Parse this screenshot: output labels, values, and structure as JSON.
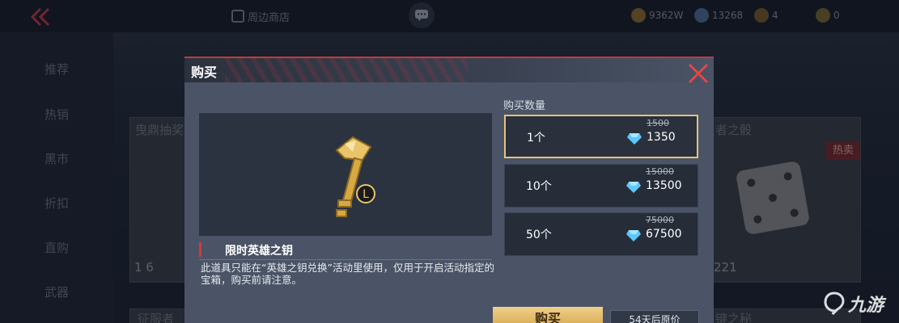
{
  "topbar": {
    "shop_tab": "周边商店",
    "currencies": [
      {
        "icon": "gold-coin-icon",
        "value": "9362W"
      },
      {
        "icon": "credit-icon",
        "value": "13268"
      },
      {
        "icon": "token-icon",
        "value": "4"
      },
      {
        "icon": "voucher-icon",
        "value": "0"
      }
    ]
  },
  "sidebar": {
    "items": [
      {
        "label": "推荐"
      },
      {
        "label": "热销"
      },
      {
        "label": "黑市"
      },
      {
        "label": "折扣"
      },
      {
        "label": "直购"
      },
      {
        "label": "武器"
      }
    ]
  },
  "background_cards": {
    "card1_title": "曳鼎抽奖",
    "card1_value": "1 6",
    "card2_title": "者之骰",
    "card2_badge": "热卖",
    "card2_value": "221",
    "bottom_left_title": "征服者",
    "bottom_right_title": "键之秘"
  },
  "modal": {
    "title": "购买",
    "item_name": "限时英雄之钥",
    "item_description": "此道具只能在“英雄之钥兑换”活动里使用，仅用于开启活动指定的宝箱，购买前请注意。",
    "quantity_label": "购买数量",
    "options": [
      {
        "qty": "1个",
        "original_price": "1500",
        "price": "1350",
        "selected": true
      },
      {
        "qty": "10个",
        "original_price": "15000",
        "price": "13500",
        "selected": false
      },
      {
        "qty": "50个",
        "original_price": "75000",
        "price": "67500",
        "selected": false
      }
    ],
    "buy_label": "购买",
    "info_label": "54天后原价"
  },
  "watermark": {
    "text": "九游"
  },
  "colors": {
    "accent_red": "#d23a3a",
    "gold": "#e7c27a",
    "diamond": "#5bc8ff"
  }
}
